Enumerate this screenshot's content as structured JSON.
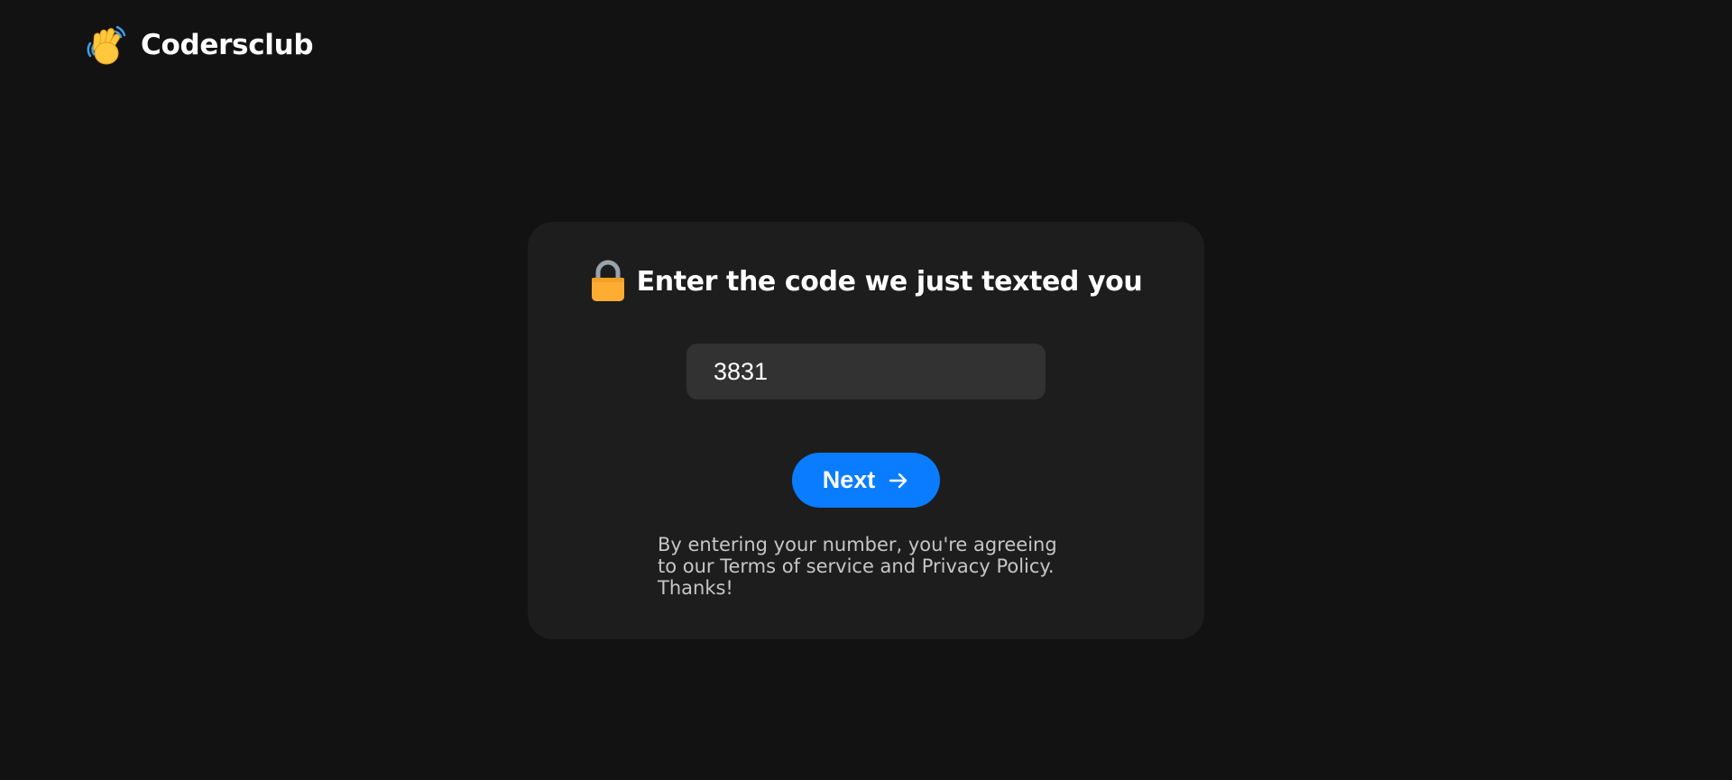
{
  "header": {
    "logo_icon": "waving-hand-icon",
    "brand_name": "Codersclub"
  },
  "card": {
    "heading_icon": "lock-icon",
    "heading": "Enter the code we just texted you",
    "code_input": {
      "value": "3831",
      "placeholder": ""
    },
    "next_button": {
      "label": "Next",
      "icon": "arrow-right-icon"
    },
    "terms": {
      "line1": "By entering your number, you're agreeing",
      "line2": "to our Terms of service and Privacy Policy.",
      "line3": "Thanks!"
    }
  },
  "colors": {
    "background": "#121212",
    "card": "#1d1d1d",
    "input": "#323232",
    "accent": "#0a7cff",
    "muted_text": "#c6c6c6"
  }
}
